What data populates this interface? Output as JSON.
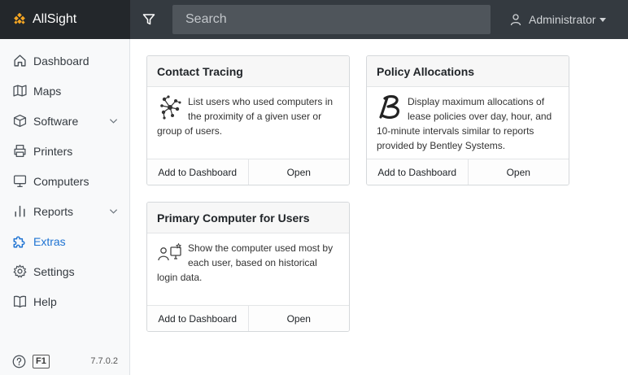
{
  "app": {
    "name": "AllSight"
  },
  "topbar": {
    "search_placeholder": "Search",
    "user_label": "Administrator"
  },
  "sidebar": {
    "items": [
      {
        "label": "Dashboard",
        "icon": "home-icon"
      },
      {
        "label": "Maps",
        "icon": "map-icon"
      },
      {
        "label": "Software",
        "icon": "box-icon",
        "expandable": true
      },
      {
        "label": "Printers",
        "icon": "printer-icon"
      },
      {
        "label": "Computers",
        "icon": "monitor-icon"
      },
      {
        "label": "Reports",
        "icon": "bar-chart-icon",
        "expandable": true
      },
      {
        "label": "Extras",
        "icon": "puzzle-icon",
        "active": true
      },
      {
        "label": "Settings",
        "icon": "gear-icon"
      },
      {
        "label": "Help",
        "icon": "book-icon"
      }
    ],
    "footer": {
      "f1_label": "F1",
      "version": "7.7.0.2"
    }
  },
  "cards": [
    {
      "title": "Contact Tracing",
      "description": "List users who used computers in the proximity of a given user or group of users.",
      "icon": "network-icon",
      "add_label": "Add to Dashboard",
      "open_label": "Open"
    },
    {
      "title": "Policy Allocations",
      "description": "Display maximum allocations of lease policies over day, hour, and 10-minute intervals similar to reports provided by Bentley Systems.",
      "icon": "bentley-logo-icon",
      "add_label": "Add to Dashboard",
      "open_label": "Open"
    },
    {
      "title": "Primary Computer for Users",
      "description": "Show the computer used most by each user, based on historical login data.",
      "icon": "user-computer-icon",
      "add_label": "Add to Dashboard",
      "open_label": "Open"
    }
  ],
  "colors": {
    "accent": "#1e73d2",
    "brand": "#f5a623",
    "topbar": "#343a40"
  }
}
